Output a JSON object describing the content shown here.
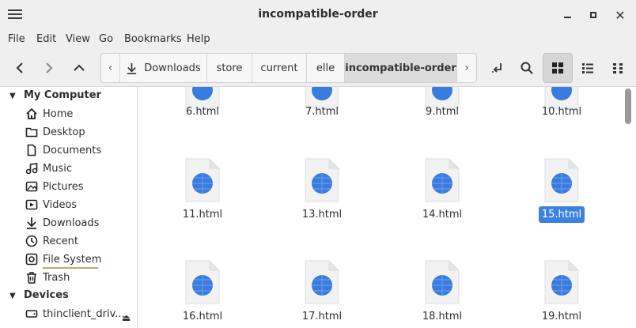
{
  "window": {
    "title": "incompatible-order"
  },
  "menubar": [
    "File",
    "Edit",
    "View",
    "Go",
    "Bookmarks",
    "Help"
  ],
  "breadcrumbs": [
    "Downloads",
    "store",
    "current",
    "elle",
    "incompatible-order"
  ],
  "sidebar": {
    "my_computer": "My Computer",
    "items": [
      "Home",
      "Desktop",
      "Documents",
      "Music",
      "Pictures",
      "Videos",
      "Downloads",
      "Recent",
      "File System",
      "Trash"
    ],
    "devices": "Devices",
    "device_items": [
      "thinclient_driv..."
    ]
  },
  "files": {
    "row0": [
      "6.html",
      "7.html",
      "9.html",
      "10.html"
    ],
    "row1": [
      "11.html",
      "13.html",
      "14.html",
      "15.html"
    ],
    "row2": [
      "16.html",
      "17.html",
      "18.html",
      "19.html"
    ],
    "selected": "15.html"
  },
  "colors": {
    "selection": "#3b82e0",
    "globe": "#3a7be0"
  }
}
